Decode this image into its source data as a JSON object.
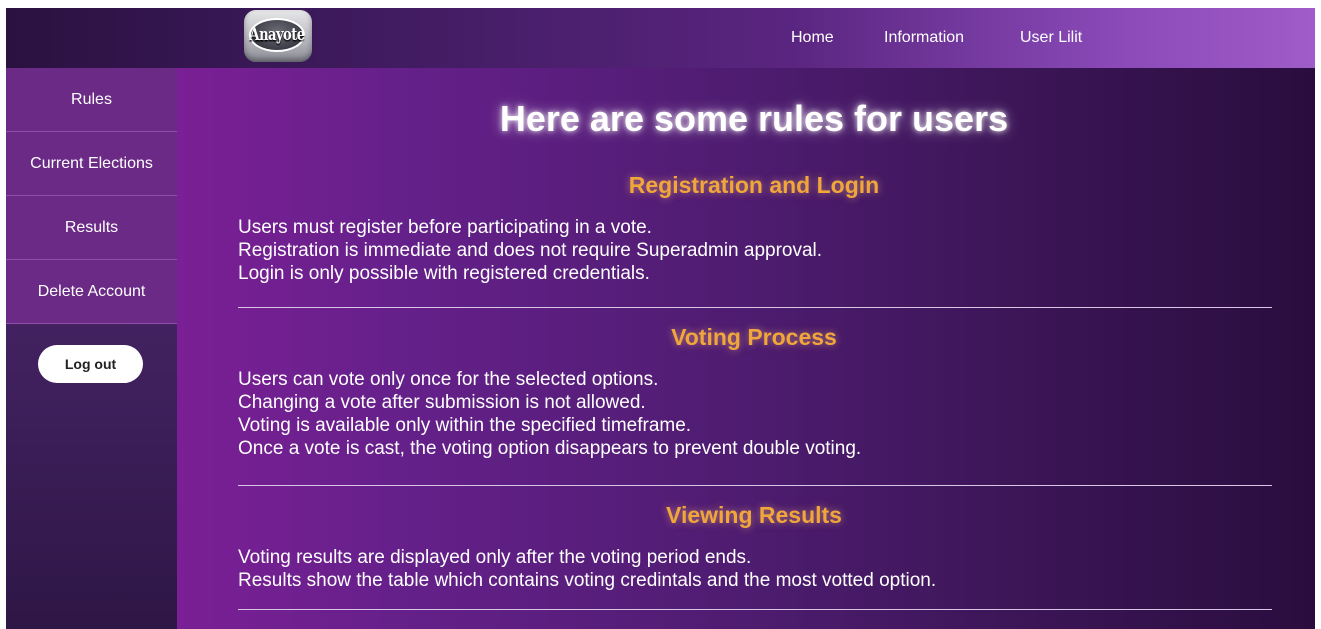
{
  "header": {
    "logo_text": "Anayote",
    "nav": {
      "home": "Home",
      "information": "Information",
      "user": "User Lilit"
    }
  },
  "sidebar": {
    "items": [
      {
        "label": "Rules"
      },
      {
        "label": "Current Elections"
      },
      {
        "label": "Results"
      },
      {
        "label": "Delete Account"
      }
    ],
    "logout_label": "Log out"
  },
  "main": {
    "title": "Here are some rules for users",
    "sections": [
      {
        "heading": "Registration and Login",
        "lines": [
          "Users must register before participating in a vote.",
          "Registration is immediate and does not require Superadmin approval.",
          "Login is only possible with registered credentials."
        ]
      },
      {
        "heading": "Voting Process",
        "lines": [
          "Users can vote only once for the selected options.",
          "Changing a vote after submission is not allowed.",
          "Voting is available only within the specified timeframe.",
          "Once a vote is cast, the voting option disappears to prevent double voting."
        ]
      },
      {
        "heading": "Viewing Results",
        "lines": [
          "Voting results are displayed only after the voting period ends.",
          "Results show the table which contains voting credintals and the most votted option."
        ]
      }
    ]
  },
  "colors": {
    "heading_accent": "#f0a63a",
    "sidebar_item_bg": "#6a2a85"
  }
}
